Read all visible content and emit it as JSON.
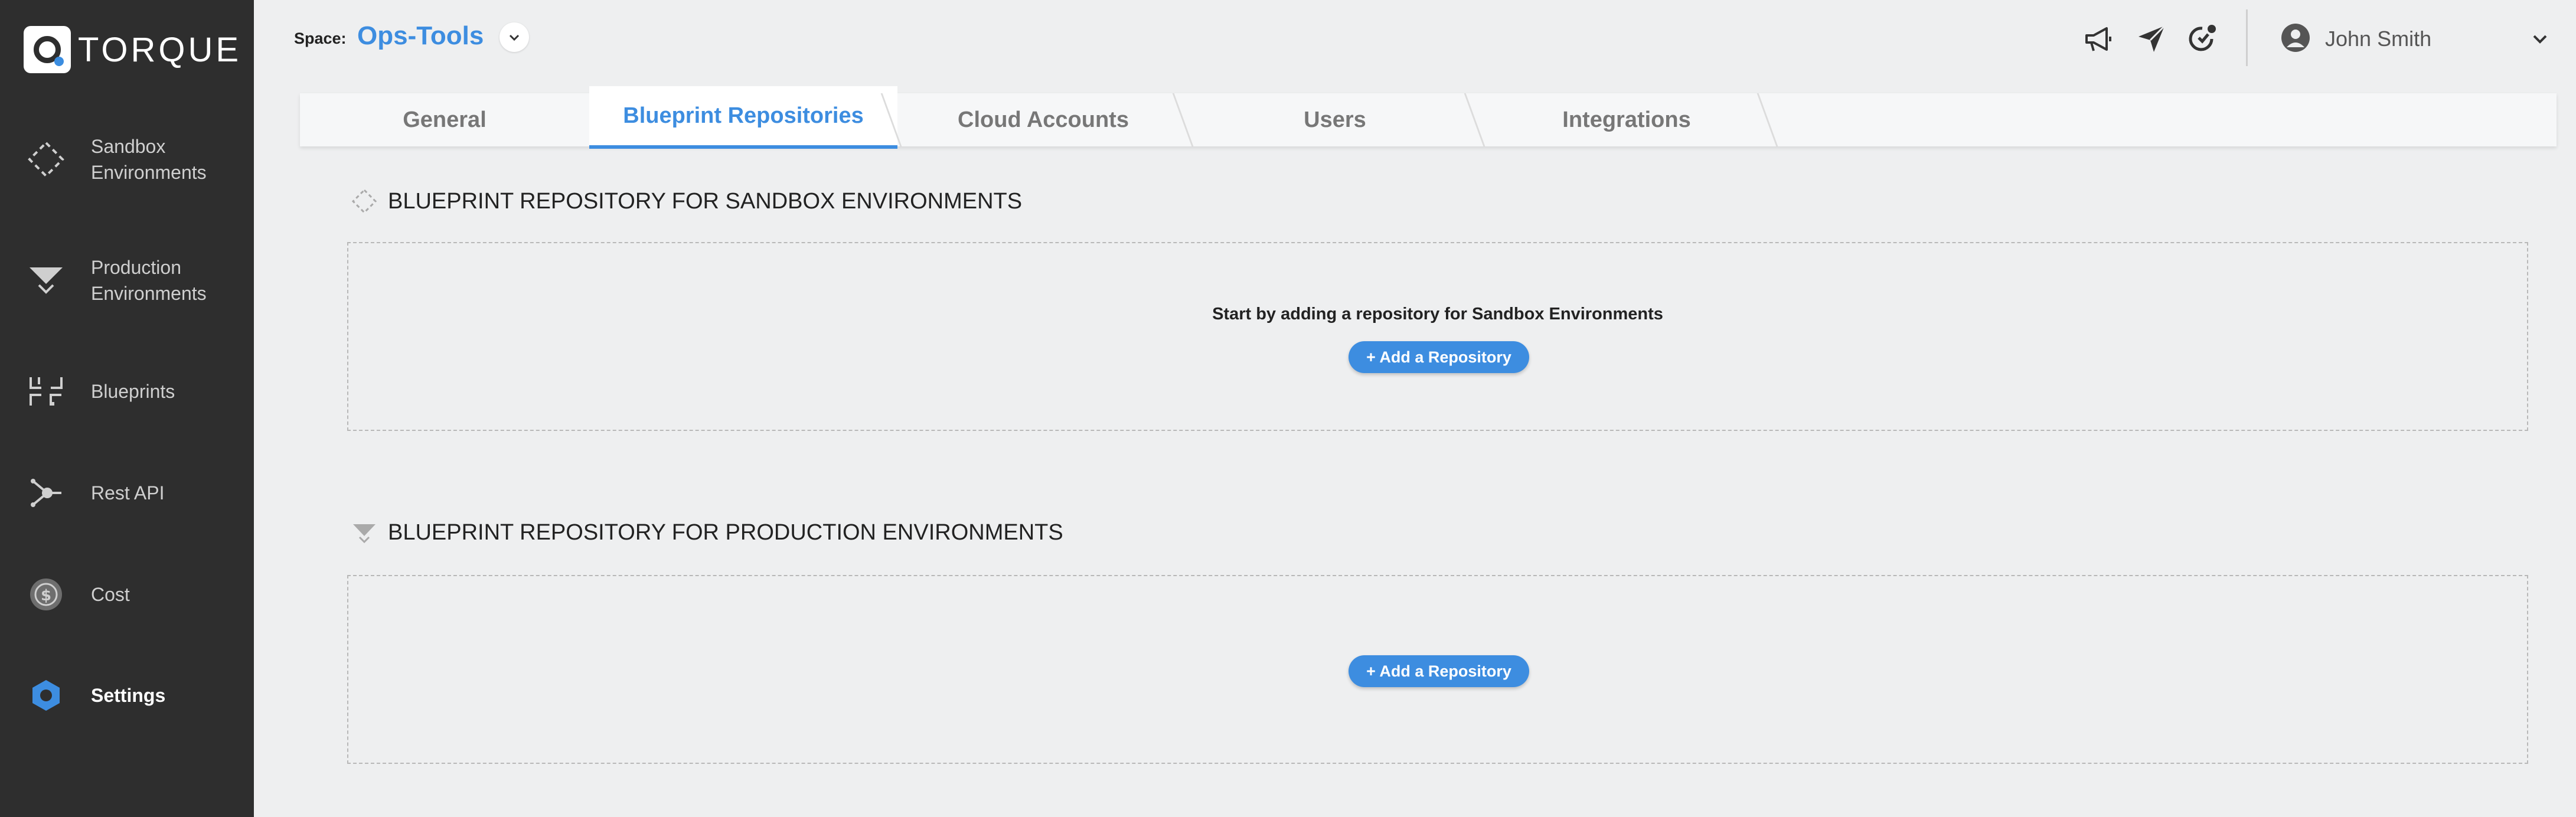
{
  "brand": {
    "name": "TORQUE",
    "accent": "#3d8de0"
  },
  "sidebar": {
    "items": [
      {
        "label": "Sandbox Environments",
        "icon": "dashed-diamond-icon"
      },
      {
        "label": "Production Environments",
        "icon": "funnel-icon"
      },
      {
        "label": "Blueprints",
        "icon": "blueprint-corners-icon"
      },
      {
        "label": "Rest API",
        "icon": "api-node-icon"
      },
      {
        "label": "Cost",
        "icon": "dollar-coin-icon"
      },
      {
        "label": "Settings",
        "icon": "gear-hexagon-icon",
        "active": true
      }
    ]
  },
  "header": {
    "space_label": "Space:",
    "space_name": "Ops-Tools",
    "icons": [
      "megaphone-icon",
      "paper-plane-icon",
      "notification-refresh-icon"
    ],
    "user_name": "John Smith"
  },
  "tabs": [
    {
      "label": "General"
    },
    {
      "label": "Blueprint Repositories",
      "active": true
    },
    {
      "label": "Cloud Accounts"
    },
    {
      "label": "Users"
    },
    {
      "label": "Integrations"
    }
  ],
  "sections": {
    "sandbox": {
      "title": "BLUEPRINT REPOSITORY FOR SANDBOX ENVIRONMENTS",
      "empty_text": "Start by adding a repository for Sandbox Environments",
      "button": "+ Add a Repository"
    },
    "production": {
      "title": "BLUEPRINT REPOSITORY FOR PRODUCTION ENVIRONMENTS",
      "button": "+ Add a Repository"
    }
  }
}
